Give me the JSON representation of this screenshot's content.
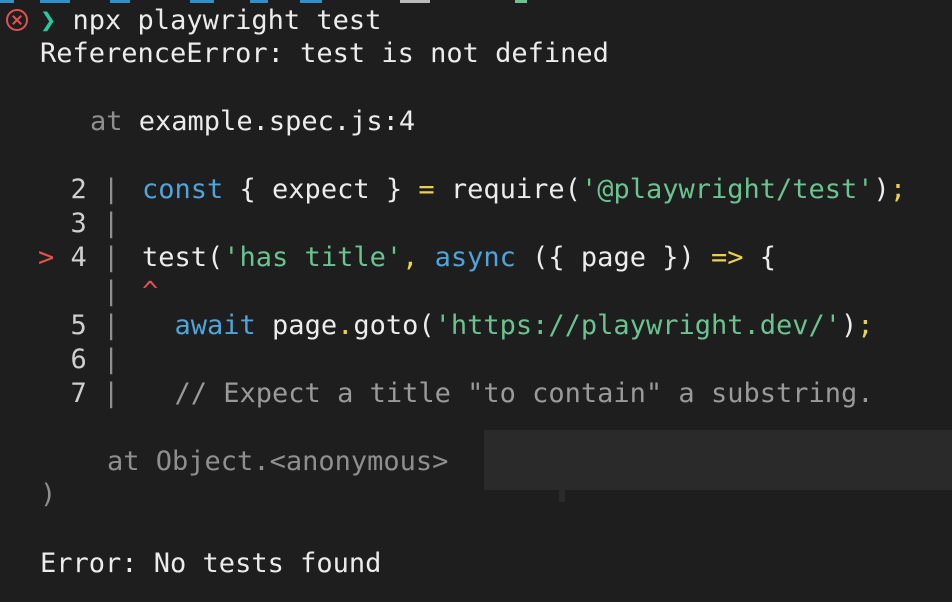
{
  "terminal": {
    "prompt_symbol": "❯",
    "command": "npx playwright test",
    "error_line": "ReferenceError: test is not defined",
    "location_at": "at",
    "location_file": "example.spec.js:4",
    "code_lines": [
      {
        "marker": " ",
        "number": "2",
        "separator": "|",
        "tokens": [
          {
            "type": "keyword",
            "text": "const"
          },
          {
            "type": "plain",
            "text": " { expect } "
          },
          {
            "type": "operator",
            "text": "="
          },
          {
            "type": "plain",
            "text": " require("
          },
          {
            "type": "string",
            "text": "'@playwright/test'"
          },
          {
            "type": "plain",
            "text": ")"
          },
          {
            "type": "operator",
            "text": ";"
          }
        ]
      },
      {
        "marker": " ",
        "number": "3",
        "separator": "|",
        "tokens": []
      },
      {
        "marker": ">",
        "number": "4",
        "separator": "|",
        "tokens": [
          {
            "type": "plain",
            "text": "test("
          },
          {
            "type": "string",
            "text": "'has title'"
          },
          {
            "type": "operator",
            "text": ","
          },
          {
            "type": "plain",
            "text": " "
          },
          {
            "type": "keyword",
            "text": "async"
          },
          {
            "type": "plain",
            "text": " ({ page }) "
          },
          {
            "type": "operator",
            "text": "=>"
          },
          {
            "type": "plain",
            "text": " {"
          }
        ]
      },
      {
        "marker": " ",
        "number": " ",
        "separator": "|",
        "caret": "^",
        "tokens": []
      },
      {
        "marker": " ",
        "number": "5",
        "separator": "|",
        "tokens": [
          {
            "type": "plain",
            "text": "  "
          },
          {
            "type": "keyword",
            "text": "await"
          },
          {
            "type": "plain",
            "text": " page"
          },
          {
            "type": "operator",
            "text": "."
          },
          {
            "type": "plain",
            "text": "goto("
          },
          {
            "type": "string",
            "text": "'https://playwright.dev/'"
          },
          {
            "type": "plain",
            "text": ")"
          },
          {
            "type": "operator",
            "text": ";"
          }
        ]
      },
      {
        "marker": " ",
        "number": "6",
        "separator": "|",
        "tokens": []
      },
      {
        "marker": " ",
        "number": "7",
        "separator": "|",
        "tokens": [
          {
            "type": "plain",
            "text": "  "
          },
          {
            "type": "comment",
            "text": "// Expect a title \"to contain\" a substring."
          }
        ]
      }
    ],
    "stack_at": "at",
    "stack_frame": "Object.<anonymous>",
    "closing_paren": ")",
    "final_error": "Error: No tests found"
  },
  "colors": {
    "background": "#1e1e1e",
    "prompt_arrow": "#29c7a0",
    "error_marker": "#e0524f",
    "keyword": "#4ea4db",
    "string": "#6ac48f",
    "operator": "#e9d34e",
    "comment": "#9a9a9a"
  },
  "icons": {
    "status": "error-circle-x-icon"
  }
}
